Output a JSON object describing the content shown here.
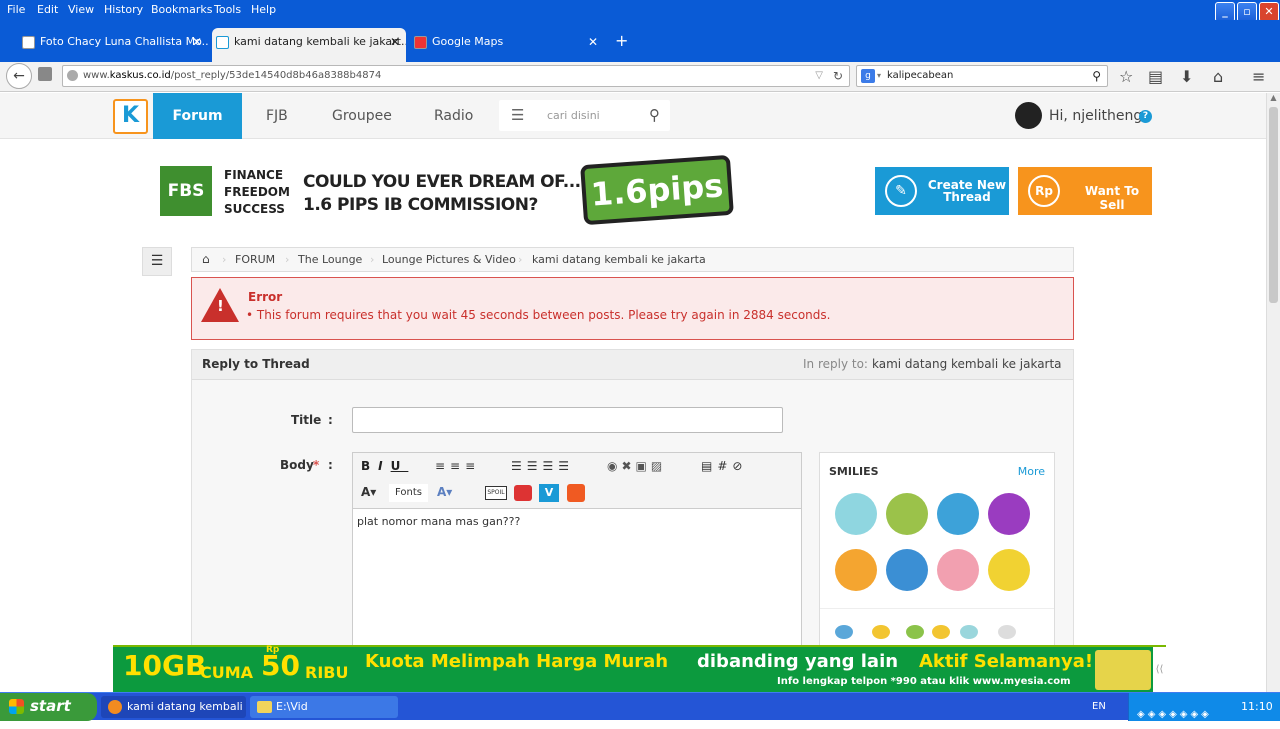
{
  "menubar": {
    "items": [
      "File",
      "Edit",
      "View",
      "History",
      "Bookmarks",
      "Tools",
      "Help"
    ]
  },
  "tabs": [
    {
      "label": "Foto Chacy Luna Challista Mo..."
    },
    {
      "label": "kami datang kembali ke jakart..."
    },
    {
      "label": "Google Maps"
    }
  ],
  "nav": {
    "url_prefix": "www.",
    "url_domain": "kaskus.co.id",
    "url_path": "/post_reply/53de14540d8b46a8388b4874",
    "search_value": "kalipecabean"
  },
  "site": {
    "nav_items": [
      "Forum",
      "FJB",
      "Groupee",
      "Radio"
    ],
    "search_placeholder": "cari disini",
    "greeting": "Hi, njelitheng"
  },
  "banner": {
    "logo": "FBS",
    "tagline": [
      "FINANCE",
      "FREEDOM",
      "SUCCESS"
    ],
    "headline1": "COULD YOU EVER DREAM OF...",
    "headline2": "1.6 PIPS IB COMMISSION?",
    "badge": "1.6pips"
  },
  "actions": {
    "create_line1": "Create New",
    "create_line2": "Thread",
    "sell": "Want To Sell",
    "sell_icon": "Rp"
  },
  "breadcrumb": [
    "FORUM",
    "The Lounge",
    "Lounge Pictures & Video",
    "kami datang kembali ke jakarta"
  ],
  "error": {
    "title": "Error",
    "message": "This forum requires that you wait 45 seconds between posts. Please try again in 2884 seconds."
  },
  "reply": {
    "header": "Reply to Thread",
    "in_reply_label": "In reply to:",
    "in_reply_value": "kami datang kembali ke jakarta",
    "title_label": "Title",
    "body_label": "Body",
    "required": "*",
    "colon": ":",
    "fonts_label": "Fonts",
    "body_text": "plat nomor mana mas gan???",
    "smilies_title": "SMILIES",
    "smilies_more": "More"
  },
  "ad": {
    "price1": "10GB",
    "price2": "CUMA",
    "price3": "50",
    "price4": "RIBU",
    "price_rp": "Rp",
    "headline": "Kuota Melimpah Harga Murah",
    "headline2": "dibanding yang lain",
    "headline3": "Aktif Selamanya!",
    "info": "Info lengkap telpon *990 atau klik www.myesia.com"
  },
  "taskbar": {
    "start": "start",
    "tasks": [
      "kami datang kembali k...",
      "E:\\Vid"
    ],
    "lang": "EN",
    "time": "11:10"
  },
  "colors": {
    "accent": "#1a9ad6",
    "sell": "#f7941d",
    "error": "#c9302c",
    "xp_blue": "#0a5bd6"
  }
}
